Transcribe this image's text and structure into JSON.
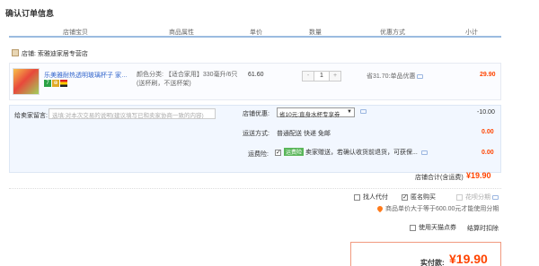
{
  "page_title": "确认订单信息",
  "columns": [
    "店铺宝贝",
    "商品属性",
    "单价",
    "数量",
    "优惠方式",
    "小计"
  ],
  "shop": {
    "label": "店铺: 索雅迪家居专营店"
  },
  "item": {
    "name": "乐美雅耐热透明玻璃杯子 家用...",
    "tags": [
      "7",
      "⊕",
      ""
    ],
    "attributes": "颜色分类: 【适合家用】330毫升/6只(送杯刷，不送杯架)",
    "price": "61.60",
    "quantity": "1",
    "qty_minus": "-",
    "qty_plus": "+",
    "promo": "省31.70:单品优惠",
    "subtotal": "29.90"
  },
  "message": {
    "label": "给卖家留言:",
    "placeholder": "选填:对本次交易的说明(建议填写已和卖家协商一致的内容)"
  },
  "shop_discount": {
    "label": "店铺优惠:",
    "selected": "省10元:直身水杯专享券",
    "value": "-10.00"
  },
  "shipping": {
    "label": "运送方式:",
    "value": "普通配送 快递 免邮",
    "amount": "0.00"
  },
  "insurance": {
    "label": "运费险:",
    "tag": "运费险",
    "text": "卖家赠送，若确认收货前退货，可获保...",
    "amount": "0.00"
  },
  "shop_total": {
    "label": "店铺合计(含运费)",
    "value": "¥19.90"
  },
  "options": {
    "proxy_pay": "找人代付",
    "anonymous": "匿名购买",
    "huabei": "花呗分期",
    "huabei_note": "商品单价大于等于600.00元才能使用分期",
    "tmall_points": "使用天猫点券",
    "settle_later": "结算时扣除"
  },
  "final": {
    "label": "实付款:",
    "value": "¥19.90"
  },
  "colors": {
    "accent": "#ff4400",
    "header_rule": "#9bbbe0",
    "link": "#3366cc"
  }
}
